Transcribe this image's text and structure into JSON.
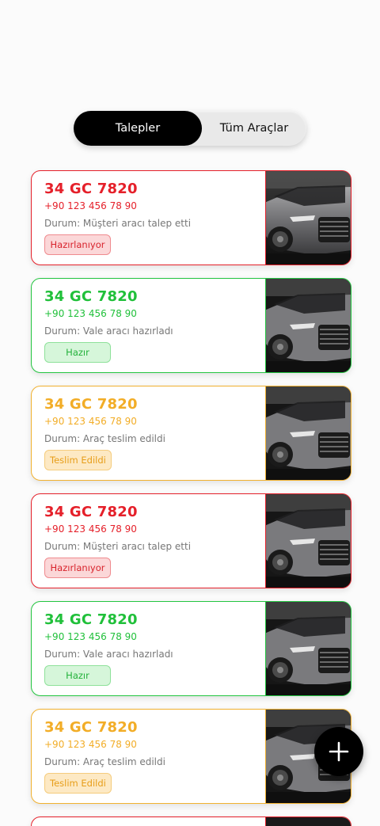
{
  "tabs": [
    {
      "label": "Talepler",
      "active": true
    },
    {
      "label": "Tüm Araçlar",
      "active": false
    }
  ],
  "requests": [
    {
      "plate": "34 GC 7820",
      "phone": "+90 123 456 78 90",
      "status": "Durum: Müşteri aracı talep etti",
      "badge": "Hazırlanıyor",
      "state": "red"
    },
    {
      "plate": "34 GC 7820",
      "phone": "+90 123 456 78 90",
      "status": "Durum: Vale aracı hazırladı",
      "badge": "Hazır",
      "state": "green"
    },
    {
      "plate": "34 GC 7820",
      "phone": "+90 123 456 78 90",
      "status": "Durum: Araç teslim edildi",
      "badge": "Teslim Edildi",
      "state": "yellow"
    },
    {
      "plate": "34 GC 7820",
      "phone": "+90 123 456 78 90",
      "status": "Durum: Müşteri aracı talep etti",
      "badge": "Hazırlanıyor",
      "state": "red"
    },
    {
      "plate": "34 GC 7820",
      "phone": "+90 123 456 78 90",
      "status": "Durum: Vale aracı hazırladı",
      "badge": "Hazır",
      "state": "green"
    },
    {
      "plate": "34 GC 7820",
      "phone": "+90 123 456 78 90",
      "status": "Durum: Araç teslim edildi",
      "badge": "Teslim Edildi",
      "state": "yellow"
    }
  ],
  "colors": {
    "red": "#e5202a",
    "green": "#23c540",
    "yellow": "#f1b12f",
    "active_tab": "#000000"
  },
  "icons": {
    "fab": "plus-icon",
    "card_image": "car-photo"
  }
}
